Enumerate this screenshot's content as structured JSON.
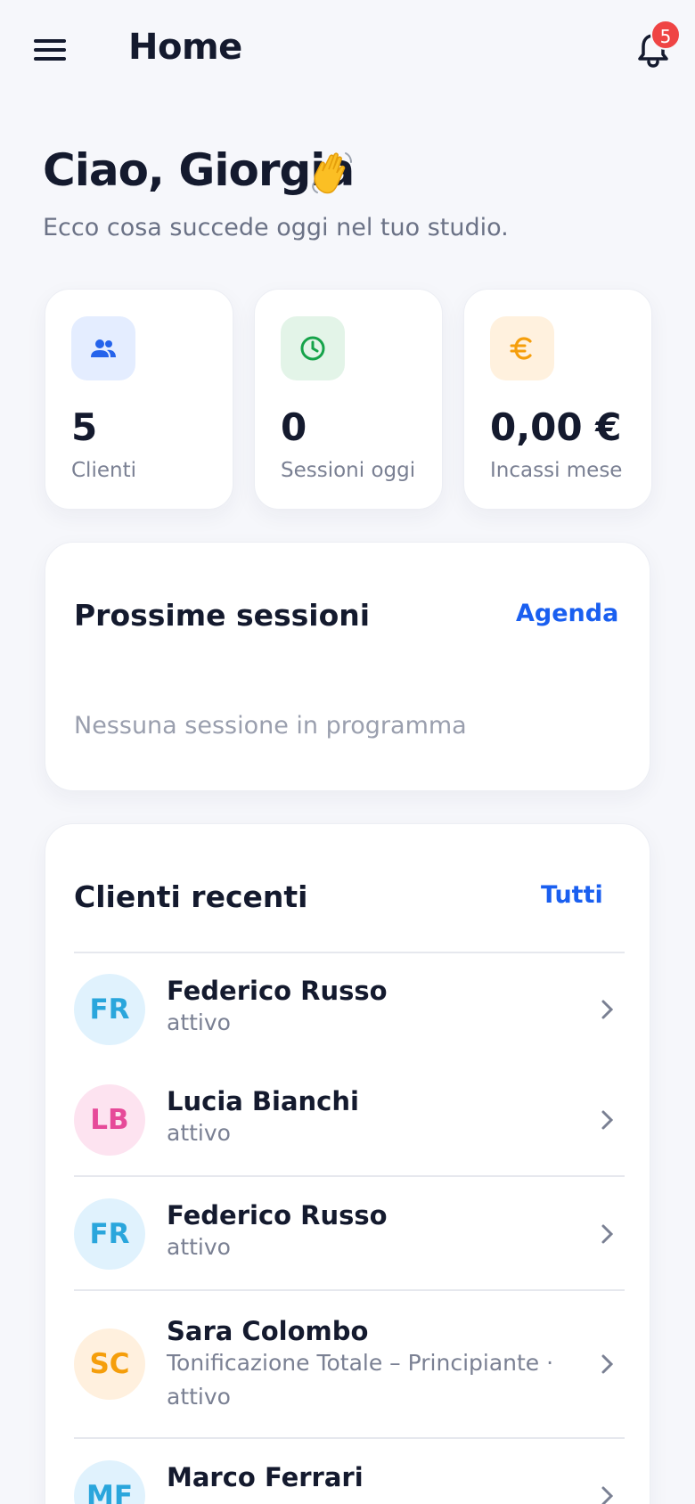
{
  "header": {
    "title": "Home",
    "notifications_count": "5"
  },
  "greeting": {
    "title": "Ciao, Giorgia",
    "subtitle": "Ecco cosa succede oggi nel tuo studio."
  },
  "stats": [
    {
      "value": "5",
      "label": "Clienti",
      "icon": "users-icon",
      "accent": "#2563eb",
      "bg": "#e4edff"
    },
    {
      "value": "0",
      "label": "Sessioni oggi",
      "icon": "clock-icon",
      "accent": "#16a34a",
      "bg": "#e3f4e8"
    },
    {
      "value": "0,00 €",
      "label": "Incassi mese",
      "icon": "euro-icon",
      "accent": "#f59e0b",
      "bg": "#fff1de"
    }
  ],
  "sessions": {
    "title": "Prossime sessioni",
    "link": "Agenda",
    "empty": "Nessuna sessione in programma"
  },
  "clients": {
    "title": "Clienti recenti",
    "link": "Tutti",
    "items": [
      {
        "initials": "FR",
        "name": "Federico Russo",
        "status": "attivo",
        "color": "#2aa6dc",
        "bg": "#e0f2fd"
      },
      {
        "initials": "LB",
        "name": "Lucia Bianchi",
        "status": "attivo",
        "color": "#e64a99",
        "bg": "#fde3f0"
      },
      {
        "initials": "FR",
        "name": "Federico Russo",
        "status": "attivo",
        "color": "#2aa6dc",
        "bg": "#e0f2fd"
      },
      {
        "initials": "SC",
        "name": "Sara Colombo",
        "program": "Tonificazione Totale – Principiante ·",
        "status": "attivo",
        "color": "#f59e0b",
        "bg": "#fff0de"
      },
      {
        "initials": "MF",
        "name": "Marco Ferrari",
        "status": "",
        "color": "#2aa6dc",
        "bg": "#e0f2fd"
      }
    ]
  },
  "colors": {
    "accent": "#1a5ff0",
    "badge": "#ef4444",
    "text": "#141a2e",
    "background": "#f6f7fb"
  }
}
